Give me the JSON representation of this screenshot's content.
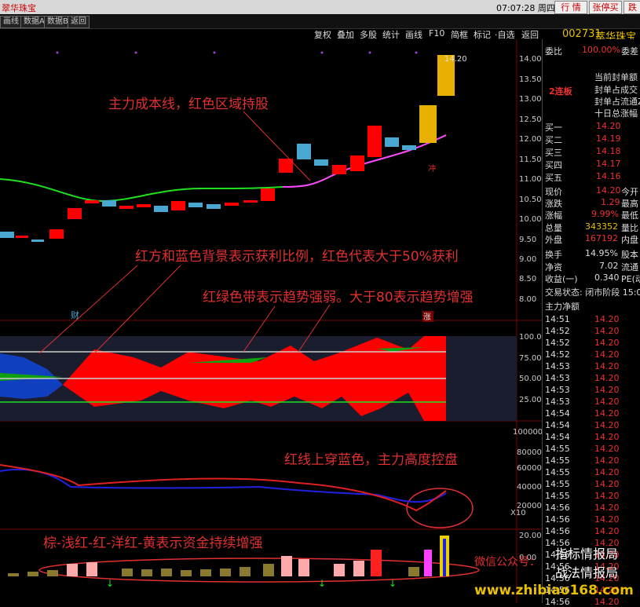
{
  "app": {
    "title": "翠华珠宝",
    "clock": "07:07:28 周四"
  },
  "top_buttons": [
    "行  情",
    "张停买",
    "跌停"
  ],
  "toolbar2": [
    "画线",
    "数据A",
    "数据B",
    "返回"
  ],
  "menu": [
    "复权",
    "叠加",
    "多股",
    "统计",
    "画线",
    "F10",
    "简框",
    "标记",
    "·自选",
    "返回"
  ],
  "stock": {
    "code": "002731",
    "name": "萃华珠宝"
  },
  "price_axis": [
    "14.00",
    "13.50",
    "13.00",
    "12.50",
    "12.00",
    "11.50",
    "11.00",
    "10.50",
    "10.00",
    "9.50",
    "9.00",
    "8.50",
    "8.00"
  ],
  "indicator_axis": [
    "100.0",
    "75.00",
    "50.00",
    "25.00"
  ],
  "volume_axis": [
    "100000",
    "80000",
    "60000",
    "40000",
    "20000",
    "X10"
  ],
  "bottom_axis": [
    "20.00",
    "0.00"
  ],
  "price_label": "14.20",
  "markers": {
    "cai": "财",
    "zhang": "涨",
    "chong": "冲"
  },
  "annotations": {
    "a1": "主力成本线，红色区域持股",
    "a2": "红方和蓝色背景表示获利比例，红色代表大于50%获利",
    "a3": "红绿色带表示趋势强弱。大于80表示趋势增强",
    "a4": "红线上穿蓝色，主力高度控盘",
    "a5": "棕-浅红-红-洋红-黄表示资金持续增强"
  },
  "ads": {
    "a1": "微信公众号：",
    "a2": "指标情报局",
    "a3": "战法情报局",
    "a4": "www.zhibiao168.com"
  },
  "panel": {
    "weibi_label": "委比",
    "weibi_value": "100.00%",
    "weicha_label": "委差",
    "lianban": "2连板",
    "fengdan": [
      "当前封单额",
      "封单占成交",
      "封单占流通Z",
      "十日总涨幅"
    ],
    "buy": [
      {
        "label": "买一",
        "price": "14.20"
      },
      {
        "label": "买二",
        "price": "14.19"
      },
      {
        "label": "买三",
        "price": "14.18"
      },
      {
        "label": "买四",
        "price": "14.17"
      },
      {
        "label": "买五",
        "price": "14.16"
      }
    ],
    "stats": [
      {
        "label": "现价",
        "value": "14.20",
        "extra": "今开",
        "color": "red"
      },
      {
        "label": "涨跌",
        "value": "1.29",
        "extra": "最高",
        "color": "red"
      },
      {
        "label": "涨幅",
        "value": "9.99%",
        "extra": "最低",
        "color": "red"
      },
      {
        "label": "总量",
        "value": "343352",
        "extra": "量比",
        "color": "yel"
      },
      {
        "label": "外盘",
        "value": "167192",
        "extra": "内盘",
        "color": "red"
      },
      {
        "label": "换手",
        "value": "14.95%",
        "extra": "股本",
        "color": "lbl"
      },
      {
        "label": "净资",
        "value": "7.02",
        "extra": "流通",
        "color": "lbl"
      },
      {
        "label": "收益(一)",
        "value": "0.340",
        "extra": "PE(动",
        "color": "lbl"
      }
    ],
    "trade_state": "交易状态: 闭市阶段 15:0",
    "zhuli": "主力净额",
    "ticks": [
      "14:51",
      "14:52",
      "14:52",
      "14:52",
      "14:53",
      "14:53",
      "14:53",
      "14:53",
      "14:54",
      "14:54",
      "14:54",
      "14:55",
      "14:55",
      "14:55",
      "14:55",
      "14:55",
      "14:56",
      "14:56",
      "14:56",
      "14:56",
      "14:56",
      "14:56",
      "14:56",
      "14:56",
      "14:56"
    ],
    "tick_price": "14.20"
  }
}
